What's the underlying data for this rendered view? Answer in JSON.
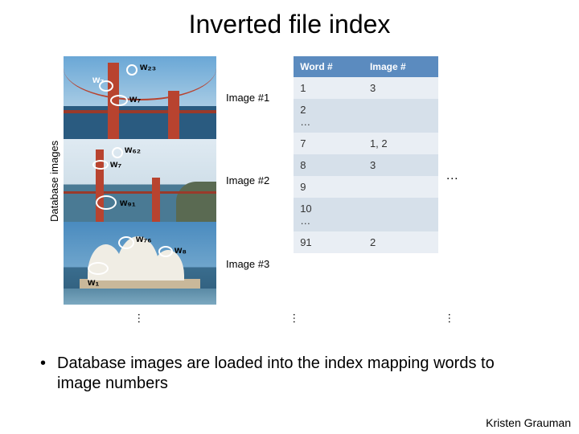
{
  "title": "Inverted file index",
  "yaxis_label": "Database images",
  "images": [
    {
      "caption": "Image #1",
      "features": [
        "w₂₃",
        "w₇",
        "w₇"
      ]
    },
    {
      "caption": "Image #2",
      "features": [
        "w₆₂",
        "w₇",
        "w₉₁"
      ]
    },
    {
      "caption": "Image #3",
      "features": [
        "w₇₆",
        "w₈",
        "w₁"
      ]
    }
  ],
  "table": {
    "headers": [
      "Word #",
      "Image #"
    ],
    "rows": [
      {
        "word": "1",
        "images": "3"
      },
      {
        "word": "2\n…",
        "images": ""
      },
      {
        "word": "7",
        "images": "1, 2"
      },
      {
        "word": "8",
        "images": "3"
      },
      {
        "word": "9",
        "images": ""
      },
      {
        "word": "10\n…",
        "images": ""
      },
      {
        "word": "91",
        "images": "2"
      }
    ],
    "side_ellipsis": "…"
  },
  "bullet_text": "Database images are loaded into the index mapping words to image numbers",
  "credit": "Kristen Grauman"
}
